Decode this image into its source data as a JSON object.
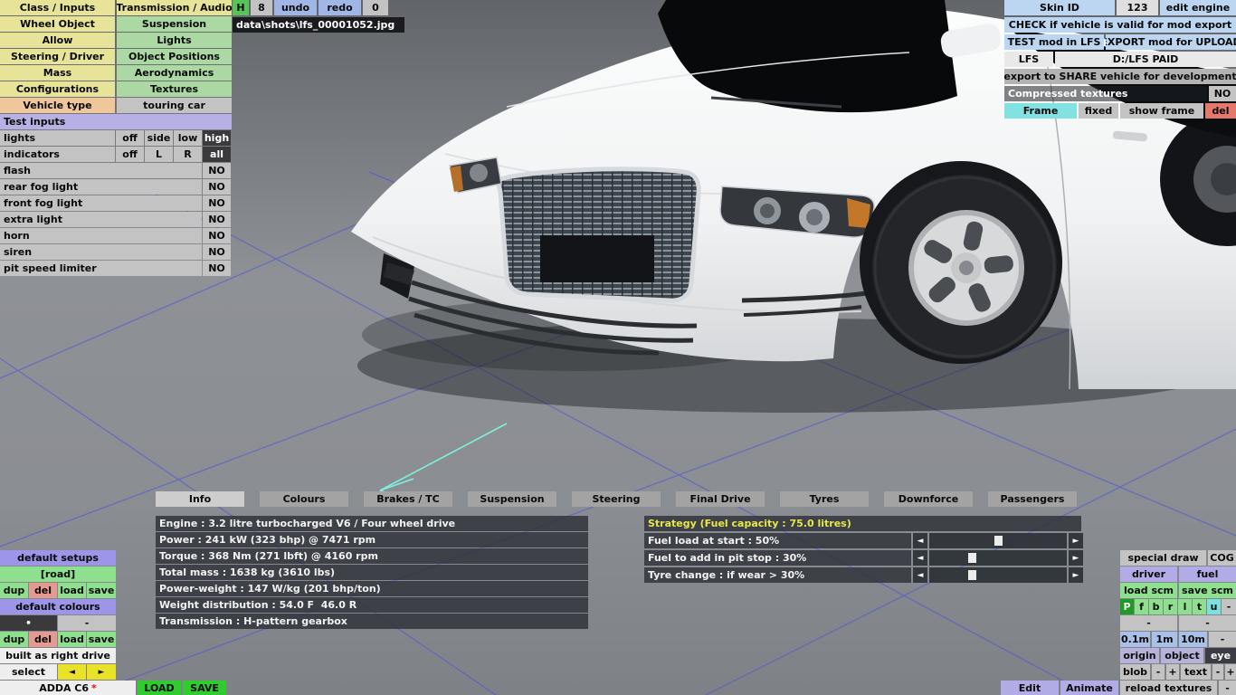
{
  "menu": {
    "rows": [
      {
        "left": "Class / Inputs",
        "right": "Transmission / Audio"
      },
      {
        "left": "Wheel Object",
        "right": "Suspension"
      },
      {
        "left": "Allow",
        "right": "Lights"
      },
      {
        "left": "Steering / Driver",
        "right": "Object Positions"
      },
      {
        "left": "Mass",
        "right": "Aerodynamics"
      },
      {
        "left": "Configurations",
        "right": "Textures"
      },
      {
        "left": "Vehicle type",
        "right": "touring car"
      }
    ]
  },
  "test_inputs": {
    "header": "Test inputs",
    "lights": {
      "label": "lights",
      "off": "off",
      "side": "side",
      "low": "low",
      "high": "high"
    },
    "indicators": {
      "label": "indicators",
      "off": "off",
      "l": "L",
      "r": "R",
      "all": "all"
    },
    "toggles": [
      {
        "label": "flash",
        "value": "NO"
      },
      {
        "label": "rear fog light",
        "value": "NO"
      },
      {
        "label": "front fog light",
        "value": "NO"
      },
      {
        "label": "extra light",
        "value": "NO"
      },
      {
        "label": "horn",
        "value": "NO"
      },
      {
        "label": "siren",
        "value": "NO"
      },
      {
        "label": "pit speed limiter",
        "value": "NO"
      }
    ]
  },
  "topbar": {
    "h": "H",
    "count": "8",
    "undo": "undo",
    "redo": "redo",
    "zero": "0",
    "screenshot_path": "data\\shots\\lfs_00001052.jpg"
  },
  "top_right": {
    "skin_id_label": "Skin ID",
    "skin_id_value": "123",
    "edit_engine": "edit engine",
    "check": "CHECK if vehicle is valid for mod export",
    "test_mod": "TEST mod in LFS",
    "export_mod": "EXPORT mod for UPLOAD",
    "lfs": "LFS",
    "lfs_path": "D:/LFS PAID",
    "share": "export to SHARE vehicle for development",
    "compressed_label": "Compressed textures",
    "compressed_value": "NO",
    "frame": "Frame",
    "fixed": "fixed",
    "show_frame": "show frame",
    "del": "del"
  },
  "tabs": {
    "items": [
      "Info",
      "Colours",
      "Brakes / TC",
      "Suspension",
      "Steering",
      "Final Drive",
      "Tyres",
      "Downforce",
      "Passengers"
    ],
    "selected": "Info"
  },
  "info_rows": [
    "Engine : 3.2 litre turbocharged V6 / Four wheel drive",
    "Power : 241 kW (323 bhp) @ 7471 rpm",
    "Torque : 368 Nm (271 lbft) @ 4160 rpm",
    "Total mass : 1638 kg (3610 lbs)",
    "Power-weight : 147 W/kg (201 bhp/ton)",
    "Weight distribution : 54.0 F  46.0 R",
    "Transmission : H-pattern gearbox"
  ],
  "strategy": {
    "header": "Strategy (Fuel capacity : 75.0 litres)",
    "arrow_left": "◄",
    "arrow_right": "►",
    "sliders": [
      {
        "label": "Fuel load at start : 50%",
        "fraction": 0.5
      },
      {
        "label": "Fuel to add in pit stop : 30%",
        "fraction": 0.3
      },
      {
        "label": "Tyre change : if wear > 30%",
        "fraction": 0.3
      }
    ]
  },
  "setups": {
    "default_setups": "default setups",
    "current": "[road]",
    "dup": "dup",
    "del": "del",
    "load": "load",
    "save": "save",
    "default_colours": "default colours",
    "dot": "•",
    "dash": "-",
    "built": "built as right drive",
    "select": "select",
    "prev": "◄",
    "next": "►"
  },
  "bottom_bar": {
    "vehicle_name": "ADDA C6",
    "star": "*",
    "load": "LOAD",
    "save": "SAVE",
    "edit": "Edit",
    "animate": "Animate",
    "reload_textures": "reload textures",
    "minus": "-"
  },
  "br": {
    "special_draw": "special draw",
    "cog": "COG",
    "driver": "driver",
    "fuel": "fuel",
    "load_scm": "load scm",
    "save_scm": "save scm",
    "letters": [
      "P",
      "f",
      "b",
      "r",
      "l",
      "t",
      "u"
    ],
    "letters_dash": "-",
    "dash1": "-",
    "dash2": "-",
    "scale_01": "0.1m",
    "scale_1": "1m",
    "scale_10": "10m",
    "scale_dash": "-",
    "origin": "origin",
    "object": "object",
    "eye": "eye",
    "blob": "blob",
    "minus1": "-",
    "plus1": "+",
    "text": "text",
    "minus2": "-",
    "plus2": "+"
  }
}
